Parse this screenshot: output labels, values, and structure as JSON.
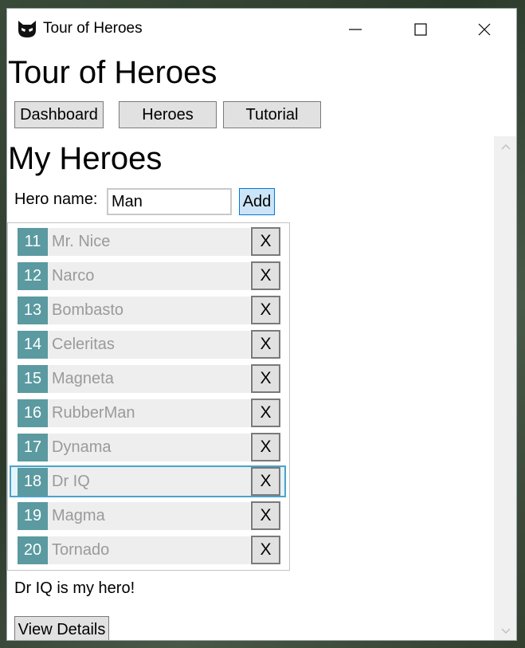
{
  "window": {
    "title": "Tour of Heroes",
    "controls": {
      "minimize_icon": "minimize-icon",
      "maximize_icon": "maximize-icon",
      "close_icon": "close-icon"
    }
  },
  "app": {
    "title": "Tour of Heroes",
    "nav": [
      "Dashboard",
      "Heroes",
      "Tutorial"
    ]
  },
  "heroes_section": {
    "title": "My Heroes",
    "name_label": "Hero name:",
    "name_value": "Man",
    "add_label": "Add",
    "delete_label": "X",
    "selected_id": 18,
    "list": [
      {
        "id": "11",
        "name": "Mr. Nice"
      },
      {
        "id": "12",
        "name": "Narco"
      },
      {
        "id": "13",
        "name": "Bombasto"
      },
      {
        "id": "14",
        "name": "Celeritas"
      },
      {
        "id": "15",
        "name": "Magneta"
      },
      {
        "id": "16",
        "name": "RubberMan"
      },
      {
        "id": "17",
        "name": "Dynama"
      },
      {
        "id": "18",
        "name": "Dr IQ"
      },
      {
        "id": "19",
        "name": "Magma"
      },
      {
        "id": "20",
        "name": "Tornado"
      }
    ]
  },
  "footer": {
    "message": "Dr IQ is my hero!",
    "view_details_label": "View Details"
  },
  "colors": {
    "id_badge": "#5a9aa0",
    "name_bg": "#eeeeee",
    "selected_border": "#4aa3c7",
    "add_button_bg": "#cce4f7"
  }
}
